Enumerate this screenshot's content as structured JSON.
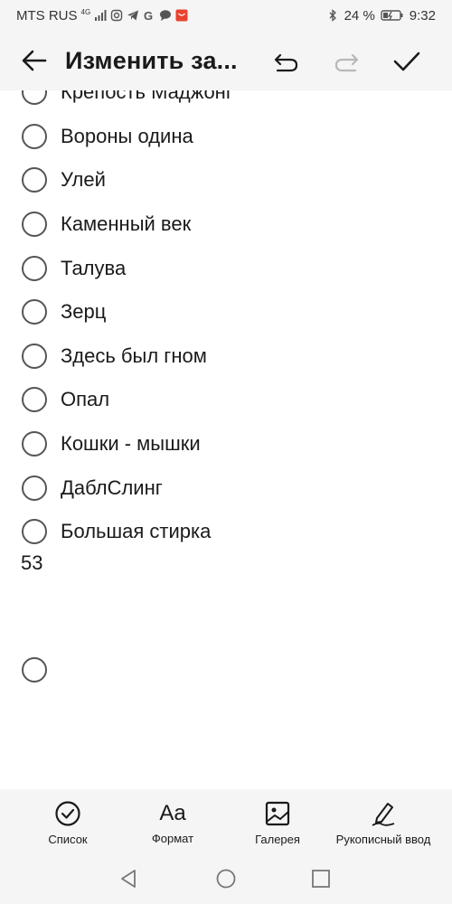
{
  "status_bar": {
    "carrier": "MTS RUS",
    "network": "4G",
    "battery": "24 %",
    "time": "9:32"
  },
  "app_bar": {
    "title": "Изменить за..."
  },
  "checklist": [
    {
      "label": "Крепость Маджонг"
    },
    {
      "label": "Вороны одина"
    },
    {
      "label": "Улей"
    },
    {
      "label": "Каменный век"
    },
    {
      "label": "Талува"
    },
    {
      "label": "Зерц"
    },
    {
      "label": "Здесь был гном"
    },
    {
      "label": "Опал"
    },
    {
      "label": "Кошки - мышки"
    },
    {
      "label": "ДаблСлинг"
    },
    {
      "label": "Большая стирка"
    }
  ],
  "free_text": "53",
  "toolbar": {
    "list_label": "Список",
    "format_label": "Формат",
    "format_glyph": "Aa",
    "gallery_label": "Галерея",
    "handwriting_label": "Рукописный ввод"
  },
  "colors": {
    "bar_background": "#f5f5f5",
    "text": "#1a1a1a",
    "radio_border": "#555555"
  }
}
